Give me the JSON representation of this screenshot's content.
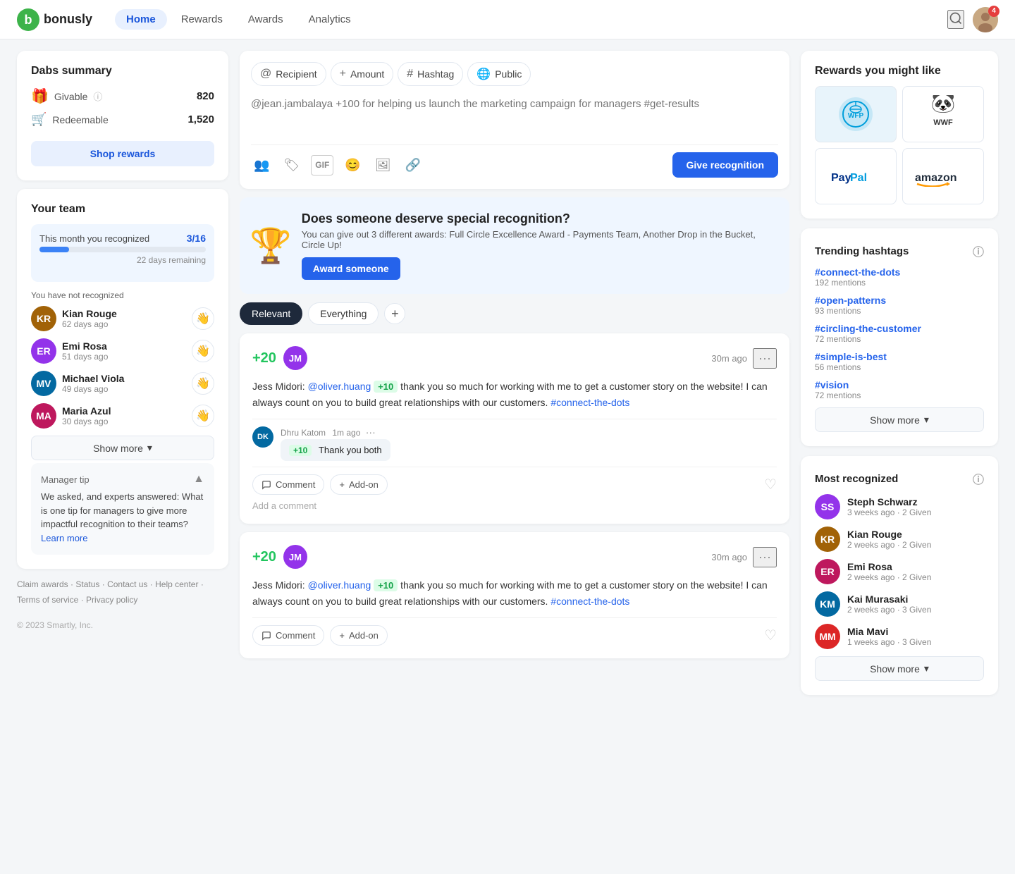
{
  "app": {
    "name": "bonusly",
    "nav": {
      "links": [
        {
          "id": "home",
          "label": "Home",
          "active": true
        },
        {
          "id": "rewards",
          "label": "Rewards",
          "active": false
        },
        {
          "id": "awards",
          "label": "Awards",
          "active": false
        },
        {
          "id": "analytics",
          "label": "Analytics",
          "active": false
        }
      ]
    },
    "notification_count": "4"
  },
  "sidebar_left": {
    "dabs_summary": {
      "title": "Dabs summary",
      "givable_label": "Givable",
      "givable_value": "820",
      "redeemable_label": "Redeemable",
      "redeemable_value": "1,520",
      "shop_btn_label": "Shop rewards"
    },
    "your_team": {
      "title": "Your team",
      "progress_label": "This month you recognized",
      "progress_fraction": "3/16",
      "days_remaining": "22 days remaining",
      "not_recognized_label": "You have not recognized",
      "members": [
        {
          "name": "Kian Rouge",
          "time": "62 days ago",
          "color": "#a16207"
        },
        {
          "name": "Emi Rosa",
          "time": "51 days ago",
          "color": "#9333ea"
        },
        {
          "name": "Michael Viola",
          "time": "49 days ago",
          "color": "#0369a1"
        },
        {
          "name": "Maria Azul",
          "time": "30 days ago",
          "color": "#be185d"
        }
      ],
      "show_more_label": "Show more"
    },
    "manager_tip": {
      "title": "Manager tip",
      "text": "We asked, and experts answered: What is one tip for managers to give more impactful recognition to their teams?",
      "link_label": "Learn more"
    }
  },
  "footer": {
    "links": [
      "Claim awards",
      "Status",
      "Contact us",
      "Help center",
      "Terms of service",
      "Privacy policy"
    ],
    "copyright": "© 2023 Smartly, Inc."
  },
  "compose": {
    "chips": [
      {
        "id": "recipient",
        "icon": "@",
        "label": "Recipient"
      },
      {
        "id": "amount",
        "icon": "+",
        "label": "Amount"
      },
      {
        "id": "hashtag",
        "icon": "#",
        "label": "Hashtag"
      },
      {
        "id": "public",
        "icon": "🌐",
        "label": "Public"
      }
    ],
    "placeholder": "@jean.jambalaya +100 for helping us launch the marketing campaign for managers #get-results",
    "give_btn_label": "Give recognition"
  },
  "award_banner": {
    "title": "Does someone deserve special recognition?",
    "description": "You can give out 3 different awards: Full Circle Excellence Award - Payments Team, Another Drop in the Bucket, Circle Up!",
    "btn_label": "Award someone"
  },
  "feed": {
    "filters": [
      {
        "id": "relevant",
        "label": "Relevant",
        "active": true
      },
      {
        "id": "everything",
        "label": "Everything",
        "active": false
      }
    ],
    "posts": [
      {
        "id": 1,
        "points": "+20",
        "time": "30m ago",
        "body_prefix": "Jess Midori:",
        "mention": "@oliver.huang",
        "points_inline": "+10",
        "body_suffix": " thank you so much for working with me to get a customer story on the website! I can always count on you to build great relationships with our customers.",
        "hashtag": "#connect-the-dots",
        "comments": [
          {
            "author": "Dhru Katom",
            "time": "1m ago",
            "points": "+10",
            "text": "Thank you both"
          }
        ],
        "add_comment_placeholder": "Add a comment",
        "comment_label": "Comment",
        "addon_label": "Add-on"
      },
      {
        "id": 2,
        "points": "+20",
        "time": "30m ago",
        "body_prefix": "Jess Midori:",
        "mention": "@oliver.huang",
        "points_inline": "+10",
        "body_suffix": " thank you so much for working with me to get a customer story on the website! I can always count on you to build great relationships with our customers.",
        "hashtag": "#connect-the-dots",
        "comments": [],
        "comment_label": "Comment",
        "addon_label": "Add-on"
      }
    ]
  },
  "sidebar_right": {
    "rewards_title": "Rewards you might like",
    "rewards": [
      {
        "id": "wfp",
        "name": "WFP",
        "bg": "#009edb"
      },
      {
        "id": "wwf",
        "name": "WWF",
        "bg": "#fff"
      },
      {
        "id": "paypal",
        "name": "PayPal",
        "bg": "#fff"
      },
      {
        "id": "amazon",
        "name": "Amazon",
        "bg": "#fff"
      }
    ],
    "trending": {
      "title": "Trending hashtags",
      "items": [
        {
          "tag": "#connect-the-dots",
          "mentions": "192 mentions"
        },
        {
          "tag": "#open-patterns",
          "mentions": "93 mentions"
        },
        {
          "tag": "#circling-the-customer",
          "mentions": "72 mentions"
        },
        {
          "tag": "#simple-is-best",
          "mentions": "56 mentions"
        },
        {
          "tag": "#vision",
          "mentions": "72 mentions"
        }
      ],
      "show_more_label": "Show more"
    },
    "most_recognized": {
      "title": "Most recognized",
      "people": [
        {
          "name": "Steph Schwarz",
          "meta": "3 weeks ago · 2 Given",
          "color": "#9333ea"
        },
        {
          "name": "Kian Rouge",
          "meta": "2 weeks ago · 2 Given",
          "color": "#a16207"
        },
        {
          "name": "Emi Rosa",
          "meta": "2 weeks ago · 2 Given",
          "color": "#9333ea"
        },
        {
          "name": "Kai Murasaki",
          "meta": "2 weeks ago · 3 Given",
          "color": "#0369a1"
        },
        {
          "name": "Mia Mavi",
          "meta": "1 weeks ago · 3 Given",
          "color": "#be185d"
        }
      ],
      "show_more_label": "Show more"
    }
  }
}
